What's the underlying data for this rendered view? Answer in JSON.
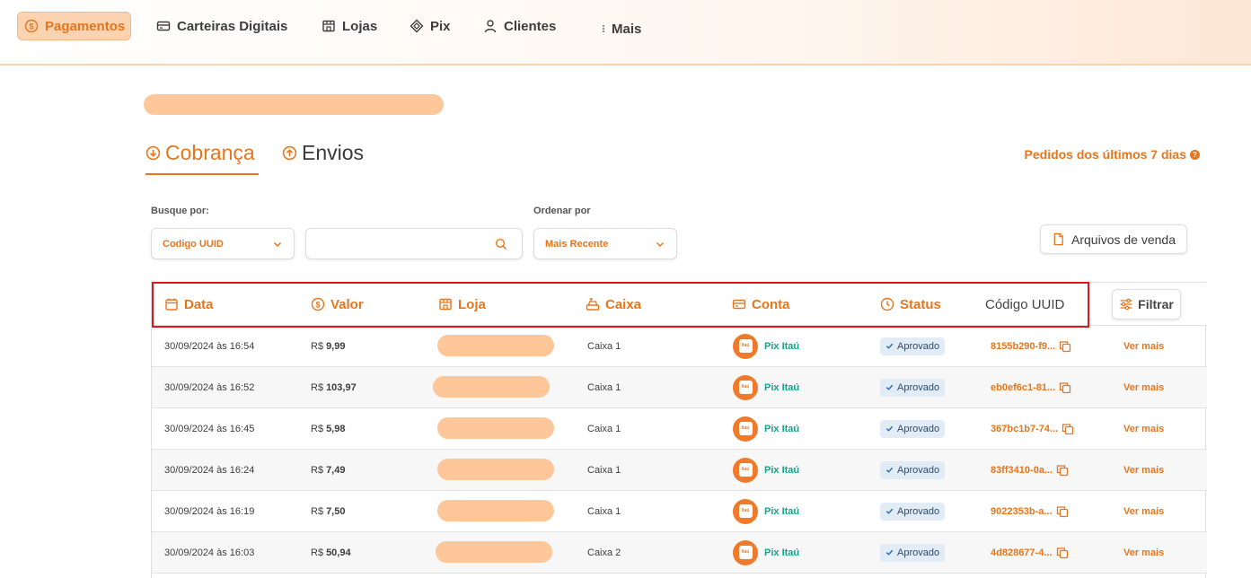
{
  "nav": {
    "items": [
      {
        "label": "Pagamentos",
        "icon": "dollar-circle-icon",
        "active": true
      },
      {
        "label": "Carteiras Digitais",
        "icon": "card-icon"
      },
      {
        "label": "Lojas",
        "icon": "store-icon"
      },
      {
        "label": "Pix",
        "icon": "pix-icon"
      },
      {
        "label": "Clientes",
        "icon": "user-icon"
      },
      {
        "label": "Mais",
        "icon": "more-vertical-icon"
      }
    ]
  },
  "tabs": {
    "cobranca": "Cobrança",
    "envios": "Envios"
  },
  "period_label": "Pedidos dos últimos 7 dias",
  "filters": {
    "search_by_label": "Busque por:",
    "search_by_value": "Codigo UUID",
    "search_placeholder": "",
    "order_label": "Ordenar por",
    "order_value": "Mais Recente",
    "files_button": "Arquivos de venda"
  },
  "table": {
    "headers": {
      "data": "Data",
      "valor": "Valor",
      "loja": "Loja",
      "caixa": "Caixa",
      "conta": "Conta",
      "status": "Status",
      "uuid": "Código UUID"
    },
    "filter_button": "Filtrar",
    "currency": "R$",
    "rows": [
      {
        "date": "30/09/2024 às 16:54",
        "value": "9,99",
        "caixa": "Caixa 1",
        "account": "Pix Itaú",
        "status": "Aprovado",
        "uuid": "8155b290-f9...",
        "action": "Ver mais"
      },
      {
        "date": "30/09/2024 às 16:52",
        "value": "103,97",
        "caixa": "Caixa 1",
        "account": "Pix Itaú",
        "status": "Aprovado",
        "uuid": "eb0ef6c1-81...",
        "action": "Ver mais"
      },
      {
        "date": "30/09/2024 às 16:45",
        "value": "5,98",
        "caixa": "Caixa 1",
        "account": "Pix Itaú",
        "status": "Aprovado",
        "uuid": "367bc1b7-74...",
        "action": "Ver mais"
      },
      {
        "date": "30/09/2024 às 16:24",
        "value": "7,49",
        "caixa": "Caixa 1",
        "account": "Pix Itaú",
        "status": "Aprovado",
        "uuid": "83ff3410-0a...",
        "action": "Ver mais"
      },
      {
        "date": "30/09/2024 às 16:19",
        "value": "7,50",
        "caixa": "Caixa 1",
        "account": "Pix Itaú",
        "status": "Aprovado",
        "uuid": "9022353b-a...",
        "action": "Ver mais"
      },
      {
        "date": "30/09/2024 às 16:03",
        "value": "50,94",
        "caixa": "Caixa 2",
        "account": "Pix Itaú",
        "status": "Aprovado",
        "uuid": "4d828677-4...",
        "action": "Ver mais"
      }
    ]
  },
  "colors": {
    "accent": "#e5761e",
    "account": "#17a28c",
    "badge_bg": "#e2ecf7",
    "highlight": "#e0161b"
  }
}
